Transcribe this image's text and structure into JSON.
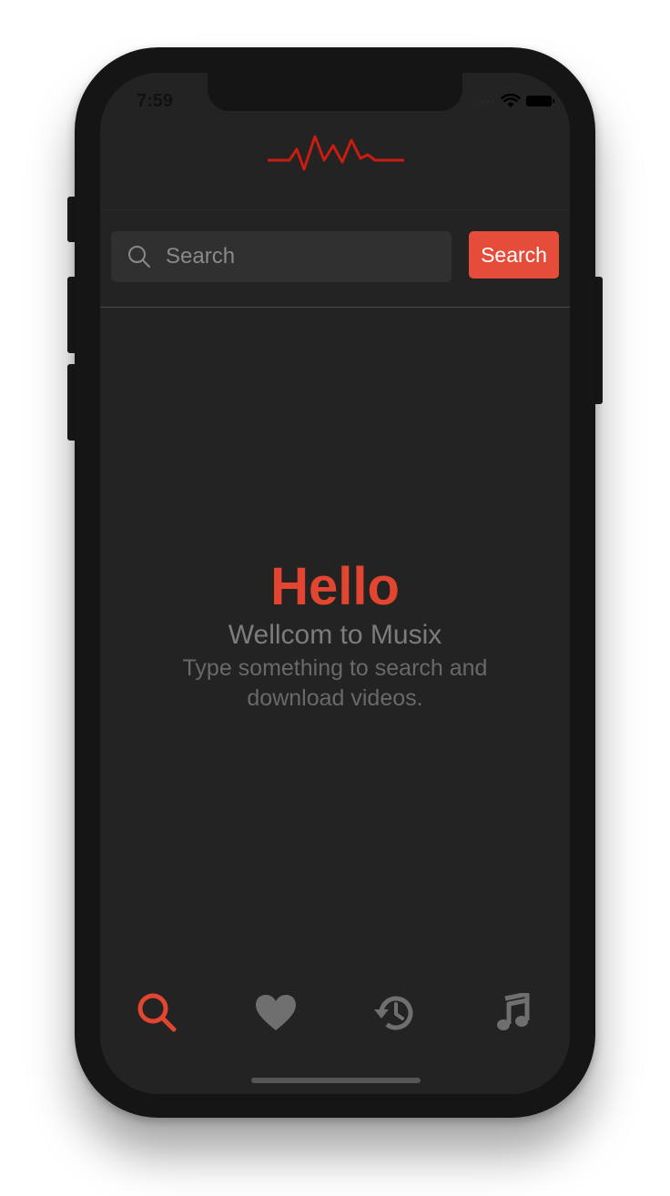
{
  "status_bar": {
    "time": "7:59",
    "icons": [
      "signal-icon",
      "wifi-icon",
      "battery-icon"
    ]
  },
  "app": {
    "name": "Musix",
    "logo_icon": "waveform-logo-icon",
    "accent_color": "#e24530"
  },
  "search": {
    "placeholder": "Search",
    "value": "",
    "button_label": "Search"
  },
  "welcome": {
    "title": "Hello",
    "subtitle": "Wellcom to Musix",
    "description": "Type something to search and download videos."
  },
  "tabbar": {
    "active_tab": "search",
    "tabs": [
      {
        "id": "search",
        "icon": "search-icon",
        "active": true
      },
      {
        "id": "favorites",
        "icon": "heart-icon",
        "active": false
      },
      {
        "id": "history",
        "icon": "history-icon",
        "active": false
      },
      {
        "id": "music",
        "icon": "music-note-icon",
        "active": false
      }
    ]
  }
}
